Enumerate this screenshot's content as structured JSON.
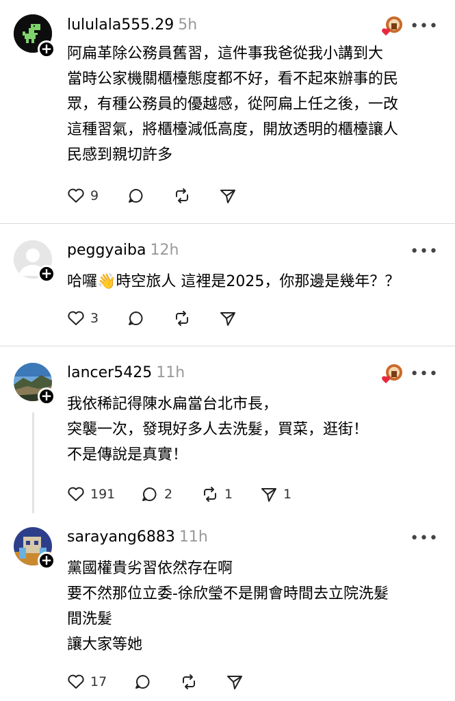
{
  "posts": [
    {
      "username": "lululala555.29",
      "time": "5h",
      "more": "•••",
      "text": "阿扁革除公務員舊習，這件事我爸從我小講到大\n當時公家機關櫃檯態度都不好，看不起來辦事的民\n眾，有種公務員的優越感，從阿扁上任之後，一改\n這種習氣，將櫃檯減低高度，開放透明的櫃檯讓人\n民感到親切許多",
      "likes": "9",
      "comments": "",
      "reposts": "",
      "shares": ""
    },
    {
      "username": "peggyaiba",
      "time": "12h",
      "more": "•••",
      "text": "哈囉👋時空旅人 這裡是2025，你那邊是幾年？？",
      "likes": "3",
      "comments": "",
      "reposts": "",
      "shares": ""
    },
    {
      "username": "lancer5425",
      "time": "11h",
      "more": "•••",
      "text": "我依稀記得陳水扁當台北市長，\n突襲一次，發現好多人去洗髮，買菜，逛街！\n不是傳說是真實！",
      "likes": "191",
      "comments": "2",
      "reposts": "1",
      "shares": "1"
    },
    {
      "username": "sarayang6883",
      "time": "11h",
      "more": "•••",
      "text": "黨國權貴劣習依然存在啊\n要不然那位立委-徐欣瑩不是開會時間去立院洗髮\n間洗髮\n讓大家等她",
      "likes": "17",
      "comments": "",
      "reposts": "",
      "shares": ""
    }
  ],
  "icons": {
    "heart": "heart-icon",
    "comment": "comment-icon",
    "repost": "repost-icon",
    "share": "share-icon",
    "follow": "plus-icon"
  },
  "colors": {
    "text": "#000000",
    "muted": "#999999",
    "divider": "#d9d9d9",
    "reaction_heart": "#e8283c"
  }
}
